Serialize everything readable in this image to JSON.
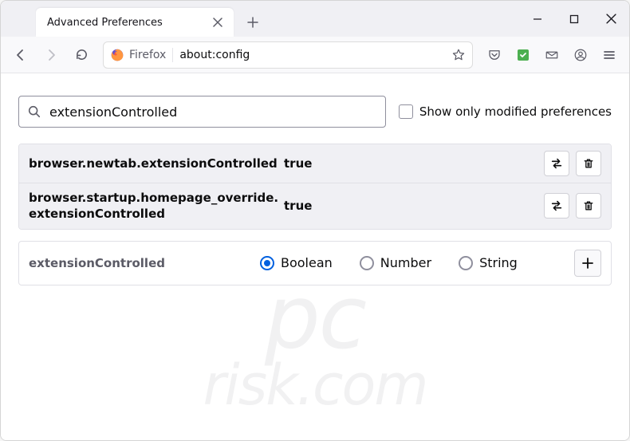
{
  "tab": {
    "title": "Advanced Preferences"
  },
  "urlbar": {
    "identity": "Firefox",
    "url": "about:config"
  },
  "search": {
    "value": "extensionControlled",
    "show_modified_label": "Show only modified preferences"
  },
  "prefs": [
    {
      "name": "browser.newtab.extensionControlled",
      "value": "true"
    },
    {
      "name": "browser.startup.homepage_override.extensionControlled",
      "value": "true"
    }
  ],
  "newpref": {
    "name": "extensionControlled",
    "options": [
      "Boolean",
      "Number",
      "String"
    ],
    "selected": 0
  }
}
